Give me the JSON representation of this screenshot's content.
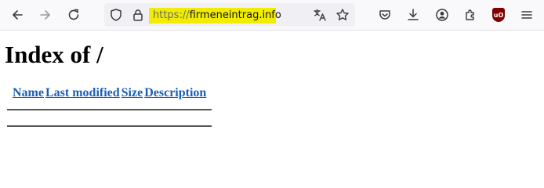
{
  "browser": {
    "url_scheme": "https://",
    "url_host": "firmeneintrag.info",
    "icons": [
      "back-icon",
      "forward-icon",
      "reload-icon",
      "shield-icon",
      "lock-icon",
      "translate-icon",
      "bookmark-star-icon",
      "pocket-icon",
      "download-icon",
      "account-icon",
      "extensions-icon",
      "ublock-origin-icon",
      "menu-icon"
    ],
    "ublock_label": "uO"
  },
  "page": {
    "title": "Index of /",
    "columns": [
      "Name",
      "Last modified",
      "Size",
      "Description"
    ]
  }
}
